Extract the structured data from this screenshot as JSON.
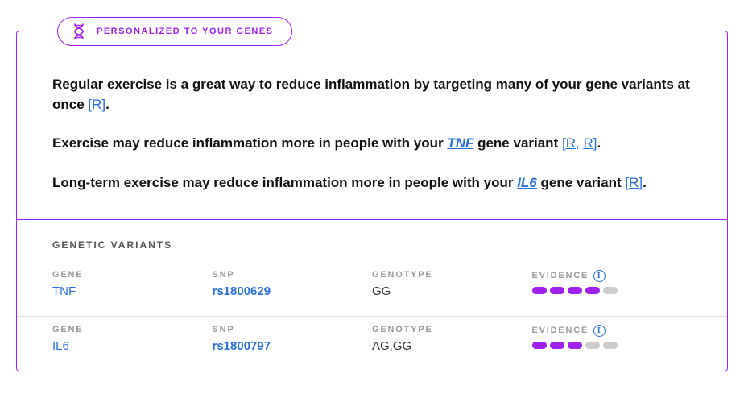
{
  "badge": {
    "label": "PERSONALIZED TO YOUR GENES"
  },
  "statements": [
    {
      "pre": "Regular exercise is a great way to reduce inflammation by targeting many of your gene variants at once ",
      "gene": null,
      "mid": "",
      "refs": [
        "R"
      ],
      "post": "."
    },
    {
      "pre": "Exercise may reduce inflammation more in people with your ",
      "gene": "TNF",
      "mid": " gene variant ",
      "refs": [
        "R",
        "R"
      ],
      "post": "."
    },
    {
      "pre": "Long-term exercise may reduce inflammation more in people with your ",
      "gene": "IL6",
      "mid": " gene variant ",
      "refs": [
        "R"
      ],
      "post": "."
    }
  ],
  "variants": {
    "title": "GENETIC VARIANTS",
    "columns": {
      "gene": "GENE",
      "snp": "SNP",
      "genotype": "GENOTYPE",
      "evidence": "EVIDENCE"
    },
    "rows": [
      {
        "gene": "TNF",
        "snp": "rs1800629",
        "genotype": "GG",
        "evidence": 4,
        "max": 5
      },
      {
        "gene": "IL6",
        "snp": "rs1800797",
        "genotype": "AG,GG",
        "evidence": 3,
        "max": 5
      }
    ]
  }
}
